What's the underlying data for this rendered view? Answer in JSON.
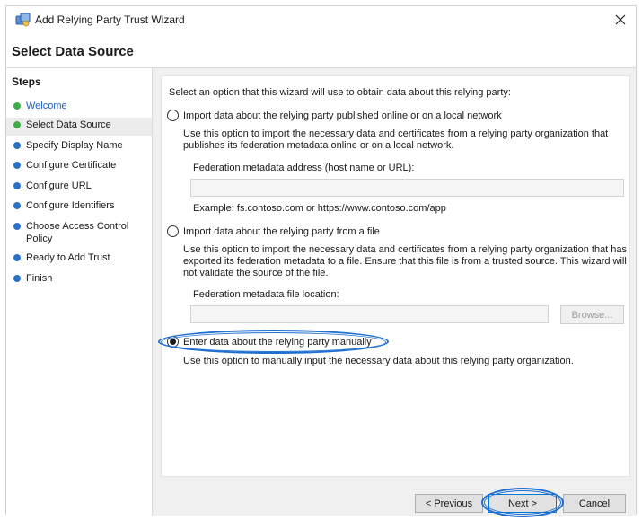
{
  "window": {
    "title": "Add Relying Party Trust Wizard",
    "page_title": "Select Data Source"
  },
  "steps": {
    "heading": "Steps",
    "items": [
      {
        "label": "Welcome",
        "status": "done"
      },
      {
        "label": "Select Data Source",
        "status": "current"
      },
      {
        "label": "Specify Display Name",
        "status": "pending"
      },
      {
        "label": "Configure Certificate",
        "status": "pending"
      },
      {
        "label": "Configure URL",
        "status": "pending"
      },
      {
        "label": "Configure Identifiers",
        "status": "pending"
      },
      {
        "label": "Choose Access Control Policy",
        "status": "pending"
      },
      {
        "label": "Ready to Add Trust",
        "status": "pending"
      },
      {
        "label": "Finish",
        "status": "pending"
      }
    ]
  },
  "main": {
    "intro": "Select an option that this wizard will use to obtain data about this relying party:",
    "option_online": {
      "label": "Import data about the relying party published online or on a local network",
      "description": "Use this option to import the necessary data and certificates from a relying party organization that publishes its federation metadata online or on a local network.",
      "field_label": "Federation metadata address (host name or URL):",
      "field_value": "",
      "example": "Example: fs.contoso.com or https://www.contoso.com/app"
    },
    "option_file": {
      "label": "Import data about the relying party from a file",
      "description": "Use this option to import the necessary data and certificates from a relying party organization that has exported its federation metadata to a file. Ensure that this file is from a trusted source.  This wizard will not validate the source of the file.",
      "field_label": "Federation metadata file location:",
      "field_value": "",
      "browse_label": "Browse..."
    },
    "option_manual": {
      "label": "Enter data about the relying party manually",
      "description": "Use this option to manually input the necessary data about this relying party organization."
    },
    "selected_option": "manual"
  },
  "buttons": {
    "previous": "< Previous",
    "next": "Next >",
    "cancel": "Cancel"
  },
  "colors": {
    "highlight": "#1f6fd0",
    "step_done": "#3fae49",
    "step_pending": "#2a72c8"
  }
}
